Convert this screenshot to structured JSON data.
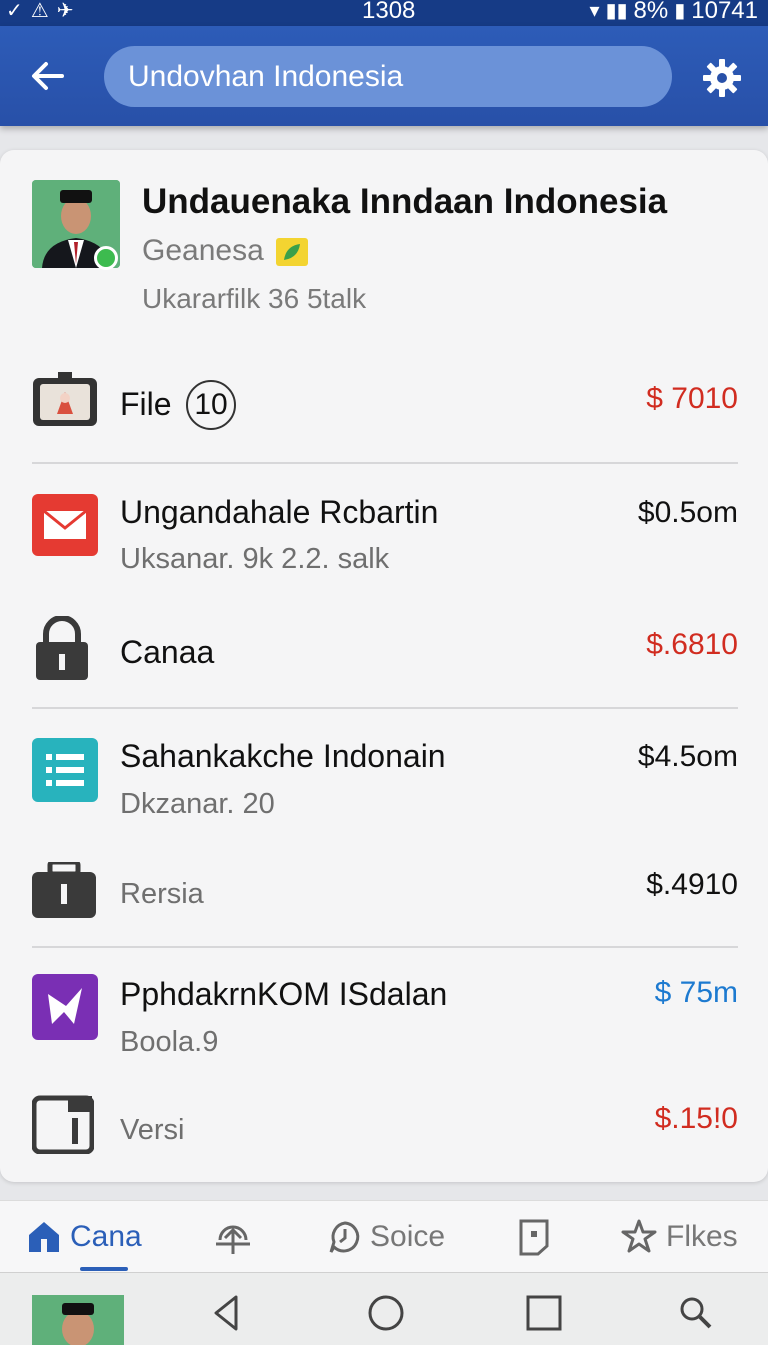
{
  "status_bar": {
    "time_center": "1308",
    "battery": "8%",
    "time_right": "10741"
  },
  "header": {
    "search_value": "Undovhan Indonesia",
    "back_icon": "arrow-left-icon",
    "settings_icon": "gear-icon"
  },
  "profile": {
    "name": "Undauenaka Inndaan Indonesia",
    "subtitle": "Geanesa",
    "detail": "Ukararfilk 36 5talk"
  },
  "rows": [
    {
      "title": "File",
      "count": "10",
      "amount": "$ 7010",
      "amount_color": "#d12c20",
      "icon": "photo-id-icon"
    },
    {
      "title": "Ungandahale Rcbartin",
      "sub": "Uksanar. 9k 2.2. salk",
      "amount": "$0.5om",
      "amount_color": "#111111",
      "icon": "mail-icon"
    },
    {
      "title": "Canaa",
      "amount": "$.6810",
      "amount_color": "#d12c20",
      "icon": "lock-icon"
    },
    {
      "title": "Sahankakche Indonain",
      "sub": "Dkzanar. 20",
      "amount": "$4.5om",
      "amount_color": "#111111",
      "icon": "list-icon"
    },
    {
      "sub": "Rersia",
      "amount": "$.4910",
      "amount_color": "#111111",
      "icon": "briefcase-icon"
    },
    {
      "title": "PphdakrnKOM ISdalan",
      "sub": "Boola.9",
      "amount": "$ 75m",
      "amount_color": "#1d7ad0",
      "icon": "app-logo-icon"
    },
    {
      "sub": "Versi",
      "amount": "$.15!0",
      "amount_color": "#d12c20",
      "icon": "document-icon"
    }
  ],
  "bottom_nav": [
    {
      "label": "Cana",
      "icon": "home-icon",
      "active": true
    },
    {
      "label": "",
      "icon": "upload-icon"
    },
    {
      "label": "Soice",
      "icon": "clock-chat-icon"
    },
    {
      "label": "",
      "icon": "note-icon"
    },
    {
      "label": "Flkes",
      "icon": "star-icon"
    }
  ]
}
